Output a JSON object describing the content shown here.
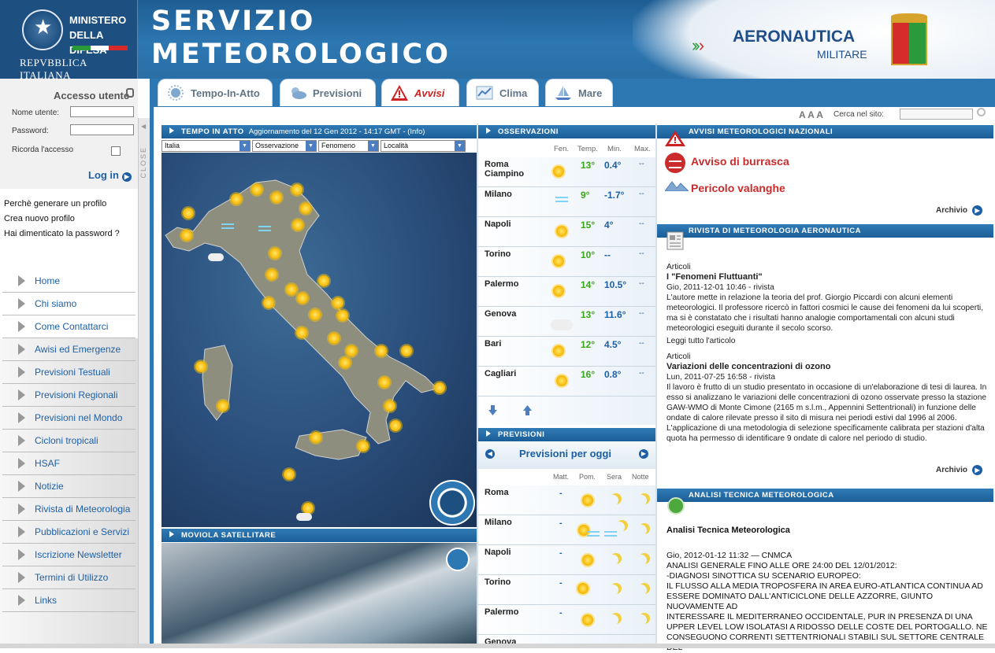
{
  "header": {
    "ministry_line1": "MINISTERO",
    "ministry_line2": "DELLA DIFESA",
    "republic": "REPVBBLICA ITALIANA",
    "title_line1": "SERVIZIO",
    "title_line2": "METEOROLOGICO",
    "brand_line1": "AERONAUTICA",
    "brand_line2": "MILITARE"
  },
  "tabs": [
    {
      "label": "Tempo-In-Atto"
    },
    {
      "label": "Previsioni"
    },
    {
      "label": "Avvisi"
    },
    {
      "label": "Clima"
    },
    {
      "label": "Mare"
    }
  ],
  "login": {
    "title": "Accesso utente",
    "user_label": "Nome utente:",
    "password_label": "Password:",
    "remember_label": "Ricorda l'accesso",
    "login_label": "Log in",
    "close_label": "CLOSE"
  },
  "profile_links": [
    "Perchè generare un profilo",
    "Crea nuovo profilo",
    "Hai dimenticato la password ?"
  ],
  "nav": [
    "Home",
    "Chi siamo",
    "Come Contattarci",
    "Awisi ed Emergenze",
    "Previsioni Testuali",
    "Previsioni Regionali",
    "Previsioni nel Mondo",
    "Cicloni tropicali",
    "HSAF",
    "Notizie",
    "Rivista di Meteorologia",
    "Pubblicazioni e Servizi",
    "Iscrizione Newsletter",
    "Termini di Utilizzo",
    "Links"
  ],
  "toolbar": {
    "font_sizes": "A A A",
    "search_label": "Cerca nel sito:"
  },
  "tempo_in_atto": {
    "title": "TEMPO IN ATTO",
    "update": "Aggiornamento del 12 Gen 2012 - 14:17 GMT - (Info)",
    "selects": [
      "Italia",
      "Osservazione",
      "Fenomeno",
      "Località"
    ]
  },
  "moviola": {
    "title": "MOVIOLA SATELLITARE"
  },
  "osservazioni": {
    "title": "OSSERVAZIONI",
    "columns": [
      "Fen.",
      "Temp.",
      "Min.",
      "Max."
    ],
    "rows": [
      {
        "city": "Roma Ciampino",
        "icon": "sun-cloud-icon",
        "temp": "13°",
        "min": "0.4°",
        "max": "--"
      },
      {
        "city": "Milano",
        "icon": "fog-icon",
        "temp": "9°",
        "min": "-1.7°",
        "max": "--"
      },
      {
        "city": "Napoli",
        "icon": "sun-icon",
        "temp": "15°",
        "min": "4°",
        "max": "--"
      },
      {
        "city": "Torino",
        "icon": "sun-cloud-icon",
        "temp": "10°",
        "min": "--",
        "max": "--"
      },
      {
        "city": "Palermo",
        "icon": "sun-cloud-icon",
        "temp": "14°",
        "min": "10.5°",
        "max": "--"
      },
      {
        "city": "Genova",
        "icon": "cloud-sun-icon",
        "temp": "13°",
        "min": "11.6°",
        "max": "--"
      },
      {
        "city": "Bari",
        "icon": "sun-icon",
        "temp": "12°",
        "min": "4.5°",
        "max": "--"
      },
      {
        "city": "Cagliari",
        "icon": "sun-icon",
        "temp": "16°",
        "min": "0.8°",
        "max": "--"
      }
    ]
  },
  "previsioni": {
    "title": "PREVISIONI",
    "subtitle": "Previsioni per oggi",
    "columns": [
      "Matt.",
      "Pom.",
      "Sera",
      "Notte"
    ],
    "rows": [
      {
        "city": "Roma",
        "matt": "-"
      },
      {
        "city": "Milano",
        "matt": "-"
      },
      {
        "city": "Napoli",
        "matt": "-"
      },
      {
        "city": "Torino",
        "matt": "-"
      },
      {
        "city": "Palermo",
        "matt": "-"
      },
      {
        "city": "Genova",
        "matt": ""
      }
    ]
  },
  "avvisi": {
    "title": "AVVISI METEOROLOGICI NAZIONALI",
    "items": [
      "Avviso di burrasca",
      "Pericolo valanghe"
    ],
    "archive": "Archivio"
  },
  "rivista": {
    "title": "RIVISTA DI METEOROLOGIA AERONAUTICA",
    "section1": "Articoli",
    "a1_title": "I \"Fenomeni Fluttuanti\"",
    "a1_date": "Gio, 2011-12-01 10:46 - rivista",
    "a1_text": "L'autore mette in relazione la teoria del prof. Giorgio Piccardi con alcuni elementi meteorologici. Il professore ricercò in fattori cosmici le cause dei fenomeni da lui scoperti, ma si è constatato che i risultati hanno analogie comportamentali con alcuni studi meteorologici eseguiti durante il secolo scorso.",
    "a1_more": "Leggi tutto l'articolo",
    "section2": "Articoli",
    "a2_title": "Variazioni delle concentrazioni di ozono",
    "a2_date": "Lun, 2011-07-25 16:58 - rivista",
    "a2_text": "Il lavoro è frutto di un studio presentato in occasione di un'elaborazione di tesi di laurea. In esso si analizzano le variazioni delle concentrazioni di ozono osservate presso la stazione GAW-WMO di Monte Cimone (2165 m s.l.m., Appennini Settentrionali) in funzione delle ondate di calore rilevate presso il sito di misura nei periodi estivi dal 1996 al 2006. L'applicazione di una metodologia di selezione specificamente calibrata per stazioni d'alta quota ha permesso di identificare 9 ondate di calore nel periodo di studio.",
    "archive": "Archivio"
  },
  "analisi": {
    "title": "ANALISI TECNICA METEOROLOGICA",
    "heading": "Analisi Tecnica Meteorologica",
    "text": "Gio, 2012-01-12 11:32 — CNMCA\nANALISI GENERALE FINO ALLE ORE 24:00 DEL 12/01/2012:\n-DIAGNOSI SINOTTICA SU SCENARIO EUROPEO:\nIL FLUSSO ALLA MEDIA TROPOSFERA IN AREA EURO-ATLANTICA CONTINUA AD ESSERE DOMINATO DALL'ANTICICLONE DELLE AZZORRE, GIUNTO NUOVAMENTE AD\nINTERESSARE IL MEDITERRANEO OCCIDENTALE, PUR IN PRESENZA DI UNA UPPER LEVEL LOW ISOLATASI A RIDOSSO DELLE COSTE DEL PORTOGALLO. NE CONSEGUONO CORRENTI SETTENTRIONALI STABILI SUL SETTORE CENTRALE DEL"
  }
}
